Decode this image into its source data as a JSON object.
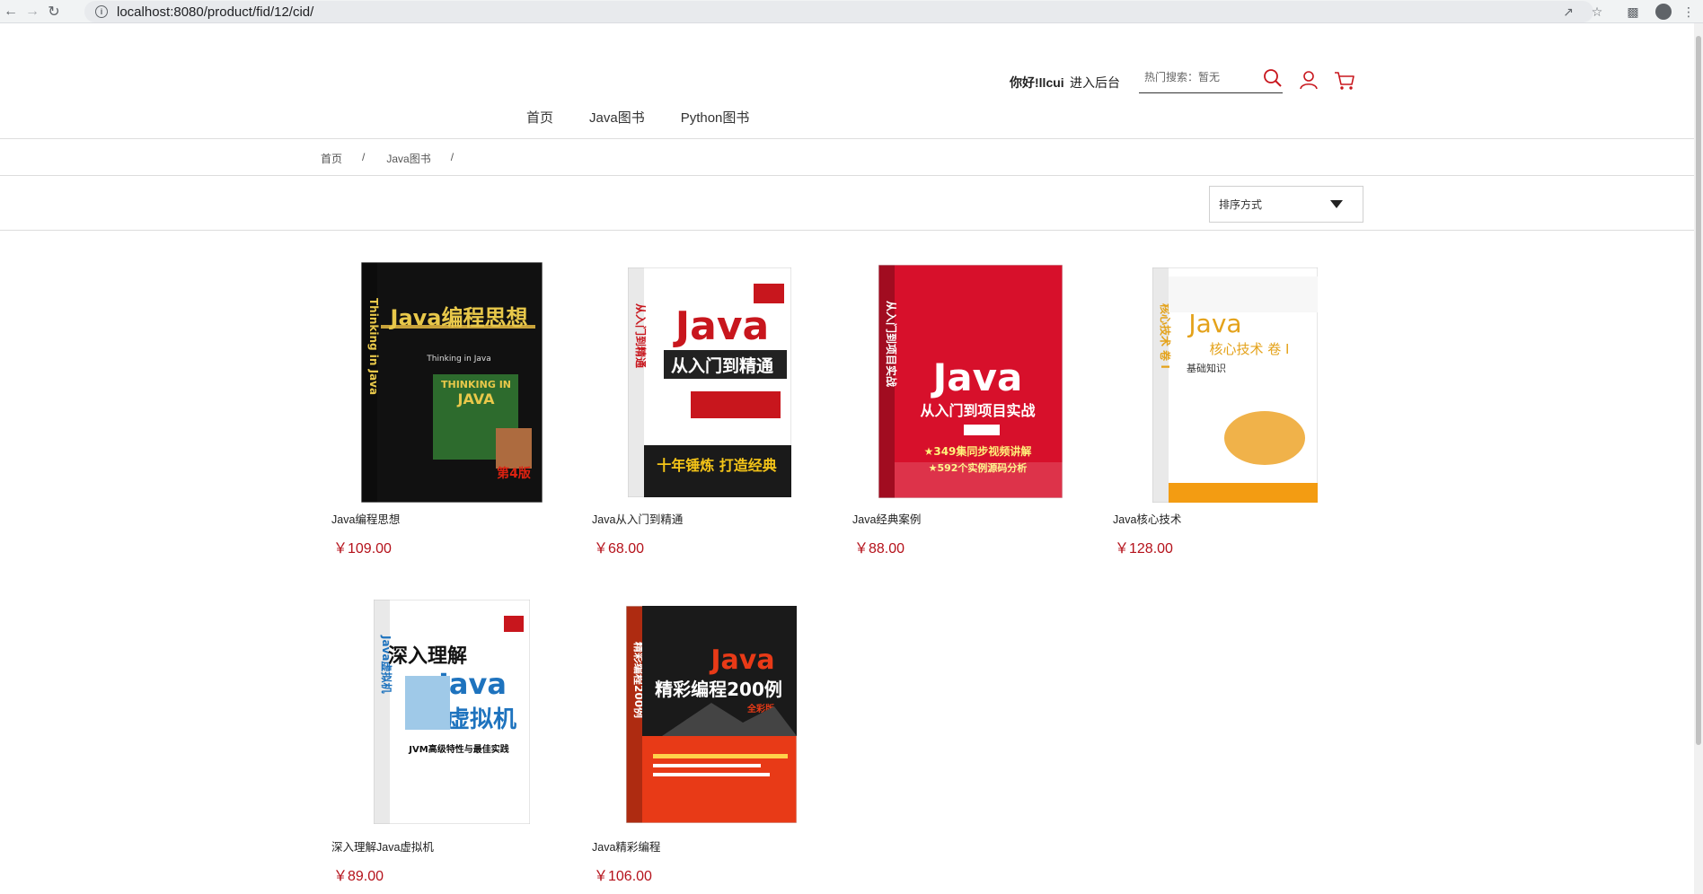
{
  "browser": {
    "url": "localhost:8080/product/fid/12/cid/"
  },
  "header": {
    "greeting": "你好!llcui",
    "admin_link": "进入后台",
    "search_placeholder": "热门搜索：暂无"
  },
  "nav": {
    "items": [
      "首页",
      "Java图书",
      "Python图书"
    ]
  },
  "breadcrumb": {
    "items": [
      "首页",
      "Java图书"
    ],
    "separator": "/"
  },
  "sort": {
    "label": "排序方式"
  },
  "products": [
    {
      "name": "Java编程思想",
      "price": "￥109.00",
      "cover": {
        "title": "Java编程思想",
        "sub": "Thinking in Java",
        "bg": "#111111",
        "fg": "#e8c84a",
        "band": "#2d6b2d"
      }
    },
    {
      "name": "Java从入门到精通",
      "price": "￥68.00",
      "cover": {
        "title": "Java",
        "sub": "从入门到精通",
        "tag": "十年锤炼 打造经典",
        "bg": "#ffffff",
        "fg": "#c8161d",
        "band": "#1a1a1a"
      }
    },
    {
      "name": "Java经典案例",
      "price": "￥88.00",
      "cover": {
        "title": "Java",
        "sub": "从入门到项目实战",
        "tag": "★349集同步视频讲解",
        "bg": "#d7102b",
        "fg": "#ffffff",
        "band": "#ffffff"
      }
    },
    {
      "name": "Java核心技术",
      "price": "￥128.00",
      "cover": {
        "title": "Java",
        "sub": "核心技术 卷 I",
        "tag": "基础知识",
        "bg": "#ffffff",
        "fg": "#e4a21a",
        "band": "#f39c12"
      }
    },
    {
      "name": "深入理解Java虚拟机",
      "price": "￥89.00",
      "cover": {
        "title": "深入理解",
        "sub": "Java虚拟机",
        "tag": "JVM高级特性与最佳实践",
        "bg": "#ffffff",
        "fg": "#1e73be",
        "band": "#9fc9e8"
      }
    },
    {
      "name": "Java精彩编程",
      "price": "￥106.00",
      "cover": {
        "title": "Java",
        "sub": "精彩编程200例",
        "tag": "全彩版",
        "bg": "#e83a17",
        "fg": "#ffffff",
        "band": "#1a1a1a"
      }
    }
  ],
  "colors": {
    "price": "#b5121b",
    "accent": "#c8161d"
  }
}
